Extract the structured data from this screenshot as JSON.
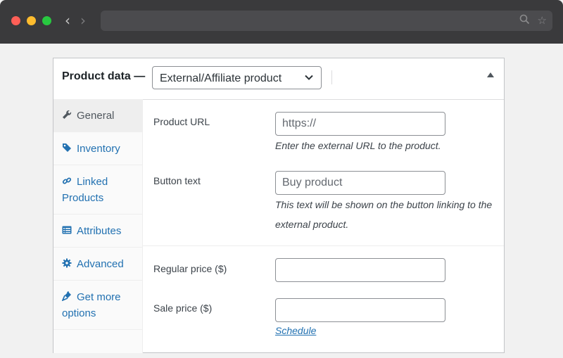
{
  "browser": {
    "nav_back_icon": "chevron-left-icon",
    "nav_forward_icon": "chevron-right-icon",
    "address_icons": [
      "search-icon",
      "star-icon"
    ]
  },
  "panel": {
    "title": "Product data —",
    "product_type": "External/Affiliate product",
    "colors": {
      "accent": "#2271b1",
      "text": "#3c434a"
    }
  },
  "tabs": [
    {
      "label": "General",
      "icon": "wrench-icon",
      "active": true
    },
    {
      "label": "Inventory",
      "icon": "tag-icon",
      "active": false
    },
    {
      "label": "Linked Products",
      "icon": "link-icon",
      "active": false
    },
    {
      "label": "Attributes",
      "icon": "list-table-icon",
      "active": false
    },
    {
      "label": "Advanced",
      "icon": "gear-icon",
      "active": false
    },
    {
      "label": "Get more options",
      "icon": "plugin-icon",
      "active": false
    }
  ],
  "fields": {
    "product_url": {
      "label": "Product URL",
      "placeholder": "https://",
      "value": "",
      "description": "Enter the external URL to the product."
    },
    "button_text": {
      "label": "Button text",
      "placeholder": "Buy product",
      "value": "",
      "description": "This text will be shown on the button linking to the external product."
    },
    "regular_price": {
      "label": "Regular price ($)",
      "value": ""
    },
    "sale_price": {
      "label": "Sale price ($)",
      "value": "",
      "schedule_link": "Schedule"
    }
  }
}
